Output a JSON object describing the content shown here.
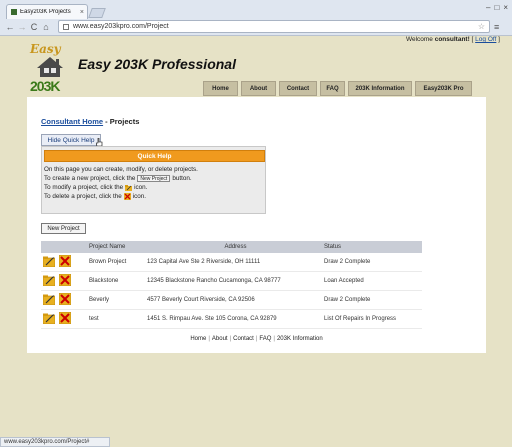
{
  "browser": {
    "tab_title": "Easy203K Projects",
    "tab_close": "×",
    "url": "www.easy203kpro.com/Project",
    "status_url": "www.easy203kpro.com/Project#",
    "window_buttons": [
      "–",
      "□",
      "×"
    ],
    "nav": {
      "back": "←",
      "forward": "→",
      "reload": "C",
      "home": "⌂",
      "star": "☆",
      "menu": "≡"
    }
  },
  "header": {
    "welcome_prefix": "Welcome ",
    "username": "consultant!",
    "logoff_open": " [ ",
    "logoff": "Log Off",
    "logoff_close": " ]",
    "logo_top": "Easy",
    "logo_bottom": "203K",
    "title": "Easy 203K Professional"
  },
  "topnav": [
    "Home",
    "About",
    "Contact",
    "FAQ",
    "203K Information",
    "Easy203K Pro"
  ],
  "breadcrumb": {
    "link": "Consultant Home",
    "sep": " - ",
    "current": "Projects"
  },
  "quick_help": {
    "toggle_label": "Hide Quick Help",
    "bar_label": "Quick Help",
    "line1": "On this page you can create, modify, or delete projects.",
    "line2_a": "To create a new project, click the",
    "line2_btn": "New Project",
    "line2_b": "button.",
    "line3_a": "To modify a project, click the",
    "line3_b": "icon.",
    "line4_a": "To delete a project, click the",
    "line4_b": "icon."
  },
  "new_project_label": "New Project",
  "table": {
    "headers": {
      "name": "Project Name",
      "address": "Address",
      "status": "Status"
    },
    "rows": [
      {
        "name": "Brown Project",
        "address": "123 Capital Ave Ste 2 Riverside, OH 11111",
        "status": "Draw 2 Complete"
      },
      {
        "name": "Blackstone",
        "address": "12345 Blackstone Rancho Cucamonga, CA 98777",
        "status": "Loan Accepted"
      },
      {
        "name": "Beverly",
        "address": "4577 Beverly Court Riverside, CA 92506",
        "status": "Draw 2 Complete"
      },
      {
        "name": "test",
        "address": "1451 S. Rimpau Ave. Ste 105 Corona, CA 92879",
        "status": "List Of Repairs In Progress"
      }
    ]
  },
  "footer": [
    "Home",
    "About",
    "Contact",
    "FAQ",
    "203K Information"
  ],
  "footer_sep": "|",
  "colors": {
    "accent": "#f09a1e",
    "link": "#1a4d9c",
    "nav_tab": "#c6bfa2",
    "page_bg": "#e6e2c6"
  },
  "icons": {
    "edit": "folder-edit-icon",
    "delete": "delete-x-icon"
  }
}
